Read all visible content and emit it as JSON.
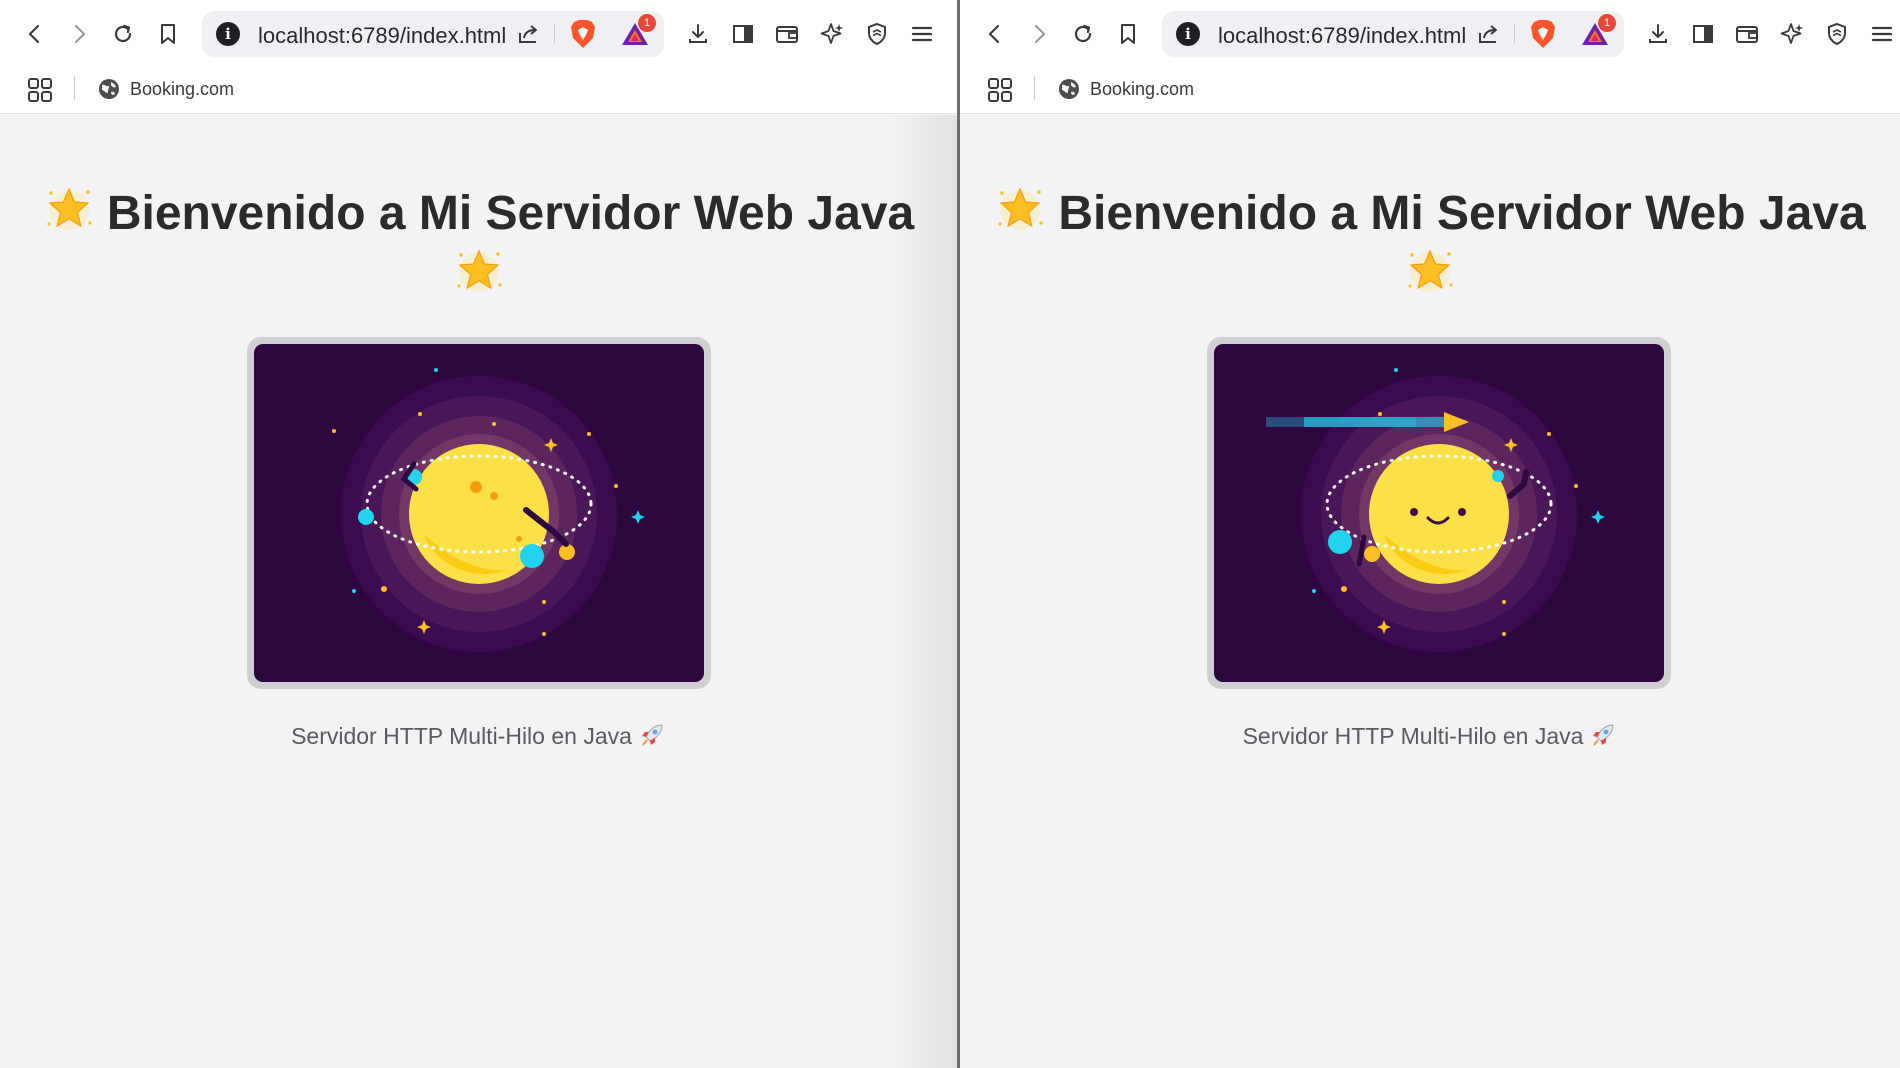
{
  "windows": [
    {
      "url": "localhost:6789/index.html",
      "shields_badge": "1",
      "bookmarks": [
        {
          "label": "Booking.com",
          "icon": "globe-icon"
        }
      ],
      "page": {
        "heading": "Bienvenido a Mi Servidor Web Java",
        "heading_icon": "star-emoji-icon",
        "caption": "Servidor HTTP Multi-Hilo en Java",
        "caption_icon": "rocket-emoji-icon",
        "illustration": "planet-with-orbit-animation-frame-1"
      }
    },
    {
      "url": "localhost:6789/index.html",
      "shields_badge": "1",
      "bookmarks": [
        {
          "label": "Booking.com",
          "icon": "globe-icon"
        }
      ],
      "page": {
        "heading": "Bienvenido a Mi Servidor Web Java",
        "heading_icon": "star-emoji-icon",
        "caption": "Servidor HTTP Multi-Hilo en Java",
        "caption_icon": "rocket-emoji-icon",
        "illustration": "planet-with-orbit-animation-frame-2"
      }
    }
  ],
  "colors": {
    "page_bg": "#f3f3f6",
    "art_bg": "#2e0740",
    "planet": "#fde047",
    "orbit_dot": "#22d3ee",
    "heading_text": "#2b2b2b",
    "brave_orange": "#fb542b"
  }
}
